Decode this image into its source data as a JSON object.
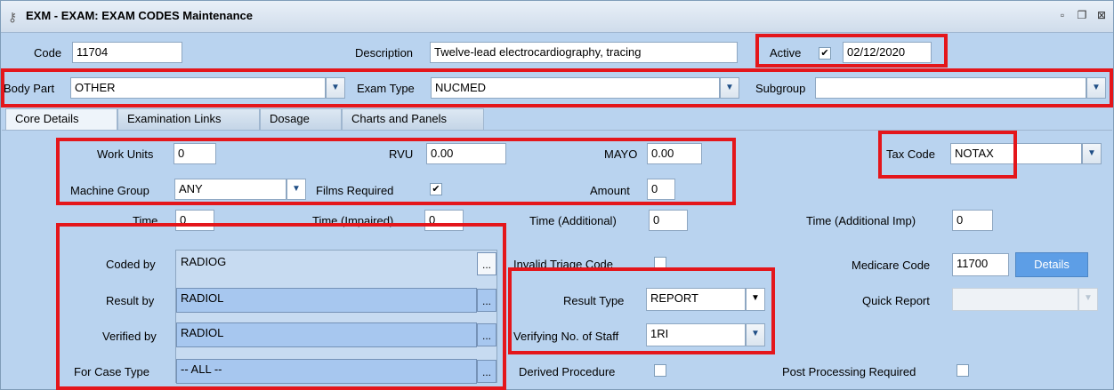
{
  "window": {
    "title": "EXM - EXAM: EXAM CODES Maintenance",
    "icon": "key-icon",
    "controls": [
      "minimize-icon",
      "restore-icon",
      "close-icon"
    ]
  },
  "header": {
    "code_label": "Code",
    "code_value": "11704",
    "description_label": "Description",
    "description_value": "Twelve-lead electrocardiography, tracing",
    "active_label": "Active",
    "active_checked": true,
    "active_date": "02/12/2020",
    "body_part_label": "Body Part",
    "body_part_value": "OTHER",
    "exam_type_label": "Exam Type",
    "exam_type_value": "NUCMED",
    "subgroup_label": "Subgroup",
    "subgroup_value": ""
  },
  "tabs": [
    {
      "label": "Core Details",
      "active": true
    },
    {
      "label": "Examination Links",
      "active": false
    },
    {
      "label": "Dosage",
      "active": false
    },
    {
      "label": "Charts and Panels",
      "active": false
    }
  ],
  "core": {
    "work_units_label": "Work Units",
    "work_units_value": "0",
    "rvu_label": "RVU",
    "rvu_value": "0.00",
    "mayo_label": "MAYO",
    "mayo_value": "0.00",
    "tax_code_label": "Tax Code",
    "tax_code_value": "NOTAX",
    "machine_group_label": "Machine Group",
    "machine_group_value": "ANY",
    "films_required_label": "Films Required",
    "films_required_checked": true,
    "amount_label": "Amount",
    "amount_value": "0",
    "time_label": "Time",
    "time_value": "0",
    "time_impaired_label": "Time (Impaired)",
    "time_impaired_value": "0",
    "time_additional_label": "Time (Additional)",
    "time_additional_value": "0",
    "time_additional_imp_label": "Time (Additional Imp)",
    "time_additional_imp_value": "0",
    "coded_by_label": "Coded by",
    "coded_by_value": "RADIOG",
    "result_by_label": "Result by",
    "result_by_value": "RADIOL",
    "verified_by_label": "Verified by",
    "verified_by_value": "RADIOL",
    "for_case_type_label": "For Case Type",
    "for_case_type_value": "-- ALL --",
    "ellipsis": "...",
    "invalid_triage_label": "Invalid Triage Code",
    "result_type_label": "Result Type",
    "result_type_value": "REPORT",
    "verifying_staff_label": "Verifying No. of Staff",
    "verifying_staff_value": "1RI",
    "derived_procedure_label": "Derived Procedure",
    "medicare_code_label": "Medicare Code",
    "medicare_code_value": "11700",
    "details_button": "Details",
    "quick_report_label": "Quick Report",
    "quick_report_value": "",
    "post_processing_label": "Post Processing Required"
  },
  "colors": {
    "panel_bg": "#b9d3ef",
    "highlight_red": "#e4161b",
    "button_blue": "#5d9ee6"
  }
}
